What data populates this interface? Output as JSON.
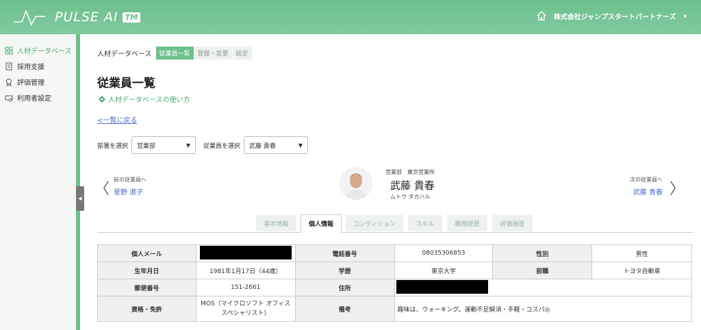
{
  "header": {
    "logo_text": "PULSE AI",
    "tm": "TM",
    "company": "株式会社ジャンプスタートパートナーズ",
    "dropdown_glyph": "∨"
  },
  "sidebar": {
    "items": [
      {
        "label": "人材データベース",
        "icon": "database-icon"
      },
      {
        "label": "採用支援",
        "icon": "document-icon"
      },
      {
        "label": "評価管理",
        "icon": "badge-icon"
      },
      {
        "label": "利用者設定",
        "icon": "settings-card-icon"
      }
    ],
    "collapse_glyph": "◀"
  },
  "breadcrumb": {
    "title": "人材データベース",
    "tabs": [
      "従業員一覧",
      "登録・変更",
      "設定"
    ]
  },
  "page": {
    "title": "従業員一覧",
    "howto": "人材データベースの使い方",
    "back": "<一覧に戻る"
  },
  "filters": {
    "dept_label": "部署を選択",
    "dept_value": "営業部",
    "emp_label": "従業員を選択",
    "emp_value": "武藤 貴春",
    "caret": "▼"
  },
  "nav": {
    "prev_label": "前の従業員へ",
    "prev_name": "星野 淑子",
    "next_label": "次の従業員へ",
    "next_name": "武藤 貴春",
    "prev_arrow": "〈",
    "next_arrow": "〉"
  },
  "employee": {
    "dept": "営業部　東京営業所",
    "name": "武藤 貴春",
    "kana": "ムトウ タカハル"
  },
  "tabs": [
    "基本情報",
    "個人情報",
    "コンディション",
    "スキル",
    "職務経歴",
    "評価履歴"
  ],
  "table": {
    "personal_email_h": "個人メール",
    "phone_h": "電話番号",
    "phone": "08035306853",
    "gender_h": "性別",
    "gender": "男性",
    "birth_h": "生年月日",
    "birth": "1981年1月17日（44歳）",
    "edu_h": "学歴",
    "edu": "東京大学",
    "prev_job_h": "前職",
    "prev_job": "トヨタ自動車",
    "zip_h": "郵便番号",
    "zip": "151-2661",
    "addr_h": "住所",
    "cert_h": "資格・免許",
    "cert": "MOS（マイクロソフト オフィス スペシャリスト）",
    "note_h": "備考",
    "note": "趣味は、ウォーキング。運動不足解消・手軽・コスパ◎"
  },
  "colors": {
    "accent": "#6cc08c",
    "link": "#4a6ad0"
  }
}
